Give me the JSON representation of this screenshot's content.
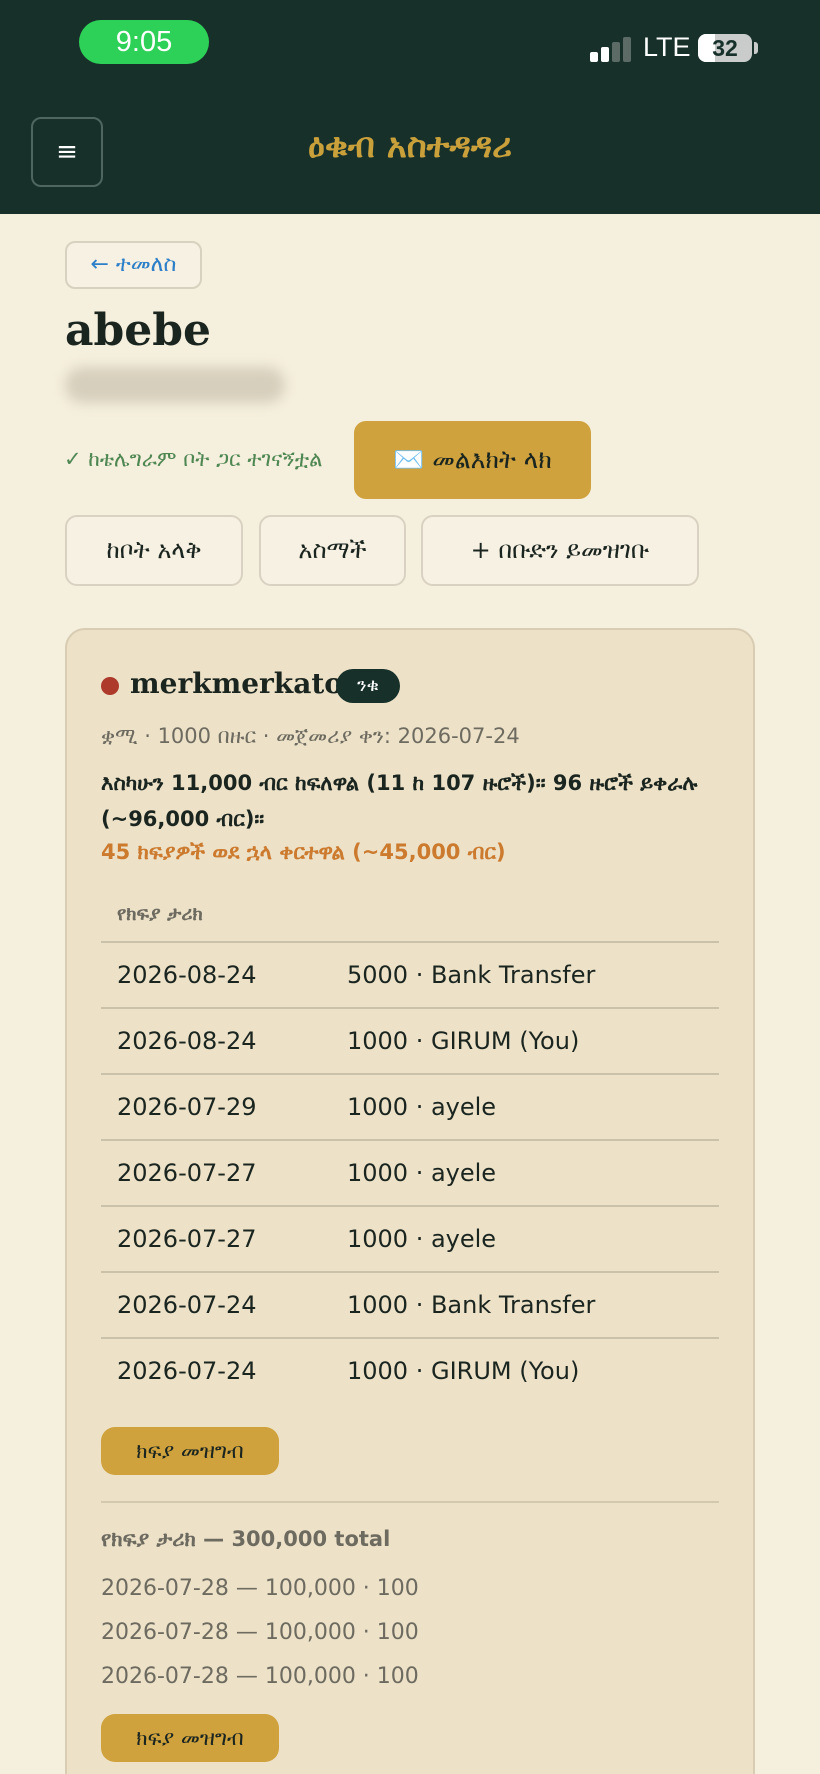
{
  "status_bar": {
    "time": "9:05",
    "network": "LTE",
    "battery": "32",
    "battery_level": 0.32
  },
  "header": {
    "menu_icon": "hamburger-icon",
    "menu_glyph": "≡",
    "title": "ዕቁብ አስተዳዳሪ"
  },
  "page": {
    "back_label": "← ተመለስ",
    "user_name": "abebe",
    "connected_label": "✓ ከቴሌግራም ቦት ጋር ተገናኝቷል",
    "message_button": "✉️ መልእክት ላክ",
    "remove_button": "ከቦት አላቅ",
    "admins_button": "አስማች",
    "register_group_button": "+ በቡድን ይመዝገቡ"
  },
  "group": {
    "name": "merkmerkato",
    "badge": "ንቁ",
    "status_color": "#ad3a2b",
    "meta": "ቋሚ · 1000 በዙር · መጀመሪያ ቀን: 2026-07-24",
    "summary": "እስካሁን 11,000 ብር ከፍለዋል (11 ከ 107 ዙሮች)። 96 ዙሮች ይቀራሉ (~96,000 ብር)።",
    "late_notice": "45 ክፍያዎች ወደ ኋላ ቀርተዋል (~45,000 ብር)",
    "history_header": "የክፍያ ታሪክ",
    "payments": [
      {
        "date": "2026-08-24",
        "detail": "5000 · Bank Transfer"
      },
      {
        "date": "2026-08-24",
        "detail": "1000 · GIRUM (You)"
      },
      {
        "date": "2026-07-29",
        "detail": "1000 · ayele"
      },
      {
        "date": "2026-07-27",
        "detail": "1000 · ayele"
      },
      {
        "date": "2026-07-27",
        "detail": "1000 · ayele"
      },
      {
        "date": "2026-07-24",
        "detail": "1000 · Bank Transfer"
      },
      {
        "date": "2026-07-24",
        "detail": "1000 · GIRUM (You)"
      }
    ],
    "record_payment_button": "ክፍያ መዝግብ",
    "payout_header": "የክፍያ ታሪክ — 300,000 total",
    "payouts": [
      "2026-07-28 — 100,000 · 100",
      "2026-07-28 — 100,000 · 100",
      "2026-07-28 — 100,000 · 100"
    ],
    "record_payout_button": "ክፍያ መዝግብ"
  }
}
